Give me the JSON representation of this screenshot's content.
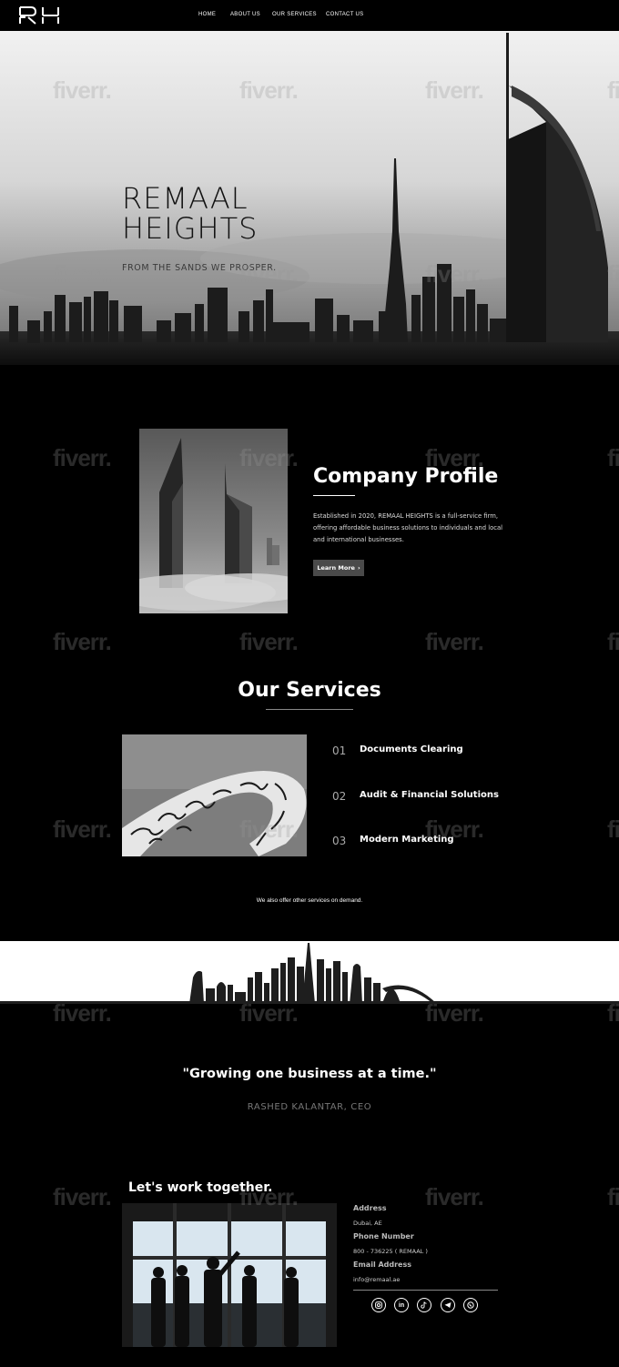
{
  "nav": {
    "logo": "RH",
    "links": [
      "HOME",
      "ABOUT US",
      "OUR SERVICES",
      "CONTACT US"
    ]
  },
  "hero": {
    "title_line1": "REMAAL",
    "title_line2": "HEIGHTS",
    "subtitle": "FROM THE SANDS WE PROSPER."
  },
  "profile": {
    "title": "Company Profile",
    "text": "Established in 2020, REMAAL HEIGHTS is a full-service firm, offering affordable business solutions to individuals and local and international businesses.",
    "button_label": "Learn More",
    "button_icon": "chevron-right-icon"
  },
  "services": {
    "title": "Our Services",
    "items": [
      {
        "num": "01",
        "label": "Documents Clearing"
      },
      {
        "num": "02",
        "label": "Audit & Financial Solutions"
      },
      {
        "num": "03",
        "label": "Modern Marketing"
      }
    ],
    "note": "We also offer other services on demand."
  },
  "quote": {
    "text": "\"Growing one business at a time.\"",
    "author": "RASHED KALANTAR, CEO"
  },
  "contact": {
    "title": "Let's work together.",
    "address_label": "Address",
    "address": "Dubai, AE",
    "phone_label": "Phone Number",
    "phone": "800 - 736225 ( REMAAL )",
    "email_label": "Email Address",
    "email": "info@remaal.ae",
    "socials": [
      "instagram-icon",
      "linkedin-icon",
      "tiktok-icon",
      "telegram-icon",
      "whatsapp-icon"
    ]
  },
  "watermark": "fiverr."
}
